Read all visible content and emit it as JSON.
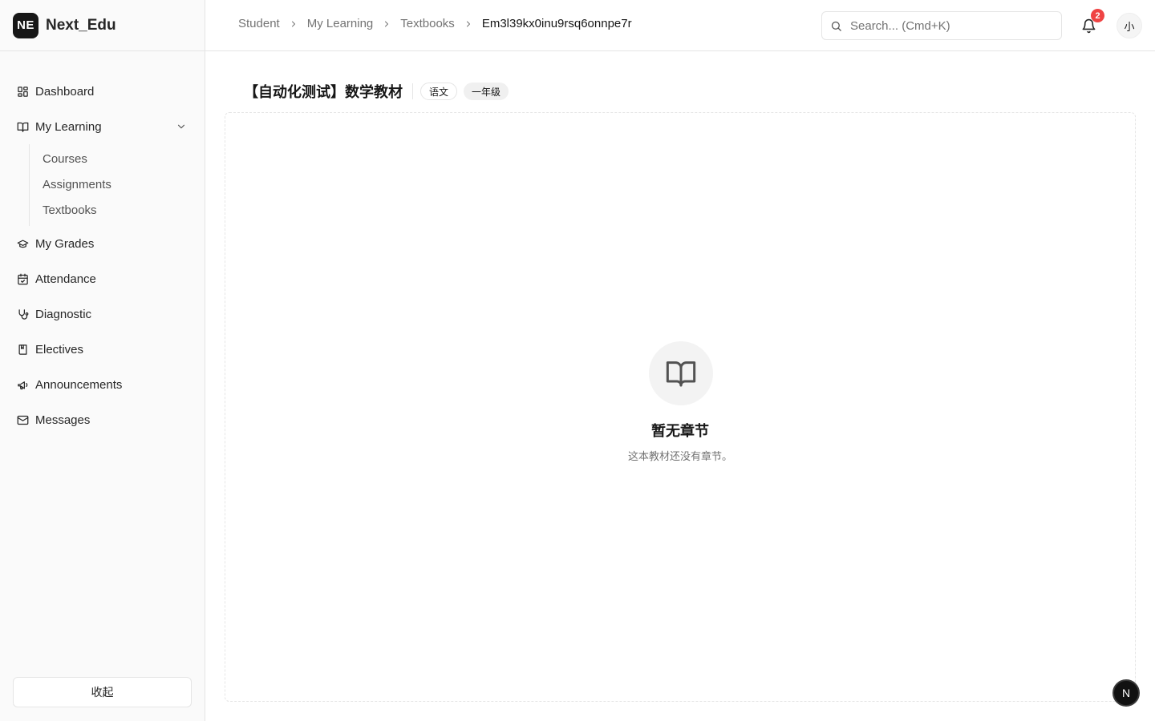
{
  "brand": {
    "logo": "NE",
    "name": "Next_Edu"
  },
  "sidebar": {
    "items": [
      {
        "label": "Dashboard",
        "icon": "dashboard-icon"
      },
      {
        "label": "My Learning",
        "icon": "book-open-icon",
        "expanded": true,
        "children": [
          {
            "label": "Courses"
          },
          {
            "label": "Assignments"
          },
          {
            "label": "Textbooks"
          }
        ]
      },
      {
        "label": "My Grades",
        "icon": "graduation-cap-icon"
      },
      {
        "label": "Attendance",
        "icon": "calendar-check-icon"
      },
      {
        "label": "Diagnostic",
        "icon": "stethoscope-icon"
      },
      {
        "label": "Electives",
        "icon": "book-marked-icon"
      },
      {
        "label": "Announcements",
        "icon": "megaphone-icon"
      },
      {
        "label": "Messages",
        "icon": "mail-icon"
      }
    ],
    "collapse_label": "收起"
  },
  "breadcrumb": [
    "Student",
    "My Learning",
    "Textbooks",
    "Em3l39kx0inu9rsq6onnpe7r"
  ],
  "search": {
    "placeholder": "Search... (Cmd+K)"
  },
  "notifications": {
    "count": "2"
  },
  "user": {
    "avatar_text": "小"
  },
  "textbook": {
    "title": "【自动化测试】数学教材",
    "subject_tag": "语文",
    "grade_tag": "一年级"
  },
  "empty_state": {
    "title": "暂无章节",
    "description": "这本教材还没有章节。"
  },
  "dev_badge": {
    "label": "N"
  },
  "colors": {
    "accent": "#171717",
    "badge": "#ef4444",
    "muted": "#737373",
    "border": "#e5e5e5"
  }
}
